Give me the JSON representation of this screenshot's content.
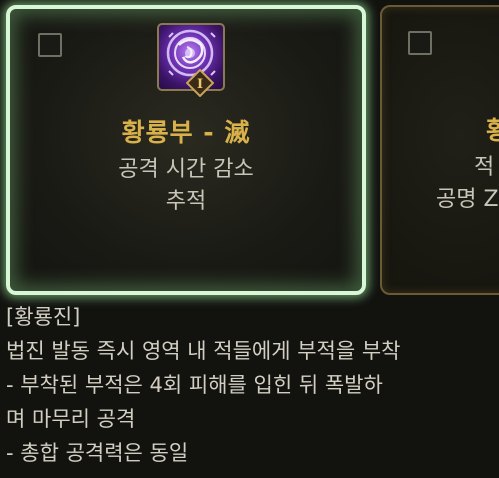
{
  "cards": [
    {
      "title": "황룡부 - 滅",
      "lines": [
        "공격 시간 감소",
        "추적"
      ],
      "selected": true,
      "icon": "purple-rune-talisman-icon",
      "badge": "I"
    },
    {
      "title": "황",
      "lines": [
        "적",
        "공명 Z"
      ],
      "selected": false
    }
  ],
  "description": {
    "heading": "[황룡진]",
    "lines": [
      "법진 발동 즉시 영역 내 적들에게 부적을 부착",
      "- 부착된 부적은 4회 피해를 입힌 뒤 폭발하",
      "며 마무리 공격",
      "- 총합 공격력은 동일"
    ]
  },
  "colors": {
    "title_gold": "#d8b14a",
    "text": "#c9c6b8",
    "selected_glow": "#d8f7d6",
    "unselected_border": "#6b5a33"
  }
}
